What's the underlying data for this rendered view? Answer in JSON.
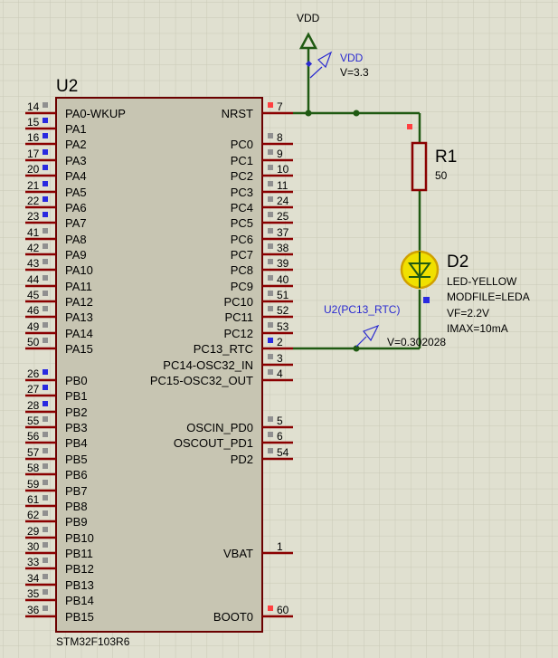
{
  "chip": {
    "ref": "U2",
    "part": "STM32F103R6",
    "left_pins": [
      {
        "num": "14",
        "name": "PA0-WKUP",
        "state": "gray"
      },
      {
        "num": "15",
        "name": "PA1",
        "state": "blue"
      },
      {
        "num": "16",
        "name": "PA2",
        "state": "blue"
      },
      {
        "num": "17",
        "name": "PA3",
        "state": "blue"
      },
      {
        "num": "20",
        "name": "PA4",
        "state": "blue"
      },
      {
        "num": "21",
        "name": "PA5",
        "state": "blue"
      },
      {
        "num": "22",
        "name": "PA6",
        "state": "blue"
      },
      {
        "num": "23",
        "name": "PA7",
        "state": "blue"
      },
      {
        "num": "41",
        "name": "PA8",
        "state": "gray"
      },
      {
        "num": "42",
        "name": "PA9",
        "state": "gray"
      },
      {
        "num": "43",
        "name": "PA10",
        "state": "gray"
      },
      {
        "num": "44",
        "name": "PA11",
        "state": "gray"
      },
      {
        "num": "45",
        "name": "PA12",
        "state": "gray"
      },
      {
        "num": "46",
        "name": "PA13",
        "state": "gray"
      },
      {
        "num": "49",
        "name": "PA14",
        "state": "gray"
      },
      {
        "num": "50",
        "name": "PA15",
        "state": "gray"
      },
      {
        "num": "26",
        "name": "PB0",
        "state": "blue"
      },
      {
        "num": "27",
        "name": "PB1",
        "state": "blue"
      },
      {
        "num": "28",
        "name": "PB2",
        "state": "blue"
      },
      {
        "num": "55",
        "name": "PB3",
        "state": "gray"
      },
      {
        "num": "56",
        "name": "PB4",
        "state": "gray"
      },
      {
        "num": "57",
        "name": "PB5",
        "state": "gray"
      },
      {
        "num": "58",
        "name": "PB6",
        "state": "gray"
      },
      {
        "num": "59",
        "name": "PB7",
        "state": "gray"
      },
      {
        "num": "61",
        "name": "PB8",
        "state": "gray"
      },
      {
        "num": "62",
        "name": "PB9",
        "state": "gray"
      },
      {
        "num": "29",
        "name": "PB10",
        "state": "gray"
      },
      {
        "num": "30",
        "name": "PB11",
        "state": "gray"
      },
      {
        "num": "33",
        "name": "PB12",
        "state": "gray"
      },
      {
        "num": "34",
        "name": "PB13",
        "state": "gray"
      },
      {
        "num": "35",
        "name": "PB14",
        "state": "gray"
      },
      {
        "num": "36",
        "name": "PB15",
        "state": "gray"
      }
    ],
    "right_pins": [
      {
        "num": "7",
        "name": "NRST",
        "state": "red"
      },
      {
        "num": "8",
        "name": "PC0",
        "state": "gray"
      },
      {
        "num": "9",
        "name": "PC1",
        "state": "gray"
      },
      {
        "num": "10",
        "name": "PC2",
        "state": "gray"
      },
      {
        "num": "11",
        "name": "PC3",
        "state": "gray"
      },
      {
        "num": "24",
        "name": "PC4",
        "state": "gray"
      },
      {
        "num": "25",
        "name": "PC5",
        "state": "gray"
      },
      {
        "num": "37",
        "name": "PC6",
        "state": "gray"
      },
      {
        "num": "38",
        "name": "PC7",
        "state": "gray"
      },
      {
        "num": "39",
        "name": "PC8",
        "state": "gray"
      },
      {
        "num": "40",
        "name": "PC9",
        "state": "gray"
      },
      {
        "num": "51",
        "name": "PC10",
        "state": "gray"
      },
      {
        "num": "52",
        "name": "PC11",
        "state": "gray"
      },
      {
        "num": "53",
        "name": "PC12",
        "state": "gray"
      },
      {
        "num": "2",
        "name": "PC13_RTC",
        "state": "blue"
      },
      {
        "num": "3",
        "name": "PC14-OSC32_IN",
        "state": "gray"
      },
      {
        "num": "4",
        "name": "PC15-OSC32_OUT",
        "state": "gray"
      },
      {
        "num": "5",
        "name": "OSCIN_PD0",
        "state": "gray"
      },
      {
        "num": "6",
        "name": "OSCOUT_PD1",
        "state": "gray"
      },
      {
        "num": "54",
        "name": "PD2",
        "state": "gray"
      },
      {
        "num": "1",
        "name": "VBAT",
        "state": "none"
      },
      {
        "num": "60",
        "name": "BOOT0",
        "state": "red"
      }
    ]
  },
  "vdd": {
    "label": "VDD",
    "probe_name": "VDD",
    "probe_value": "V=3.3"
  },
  "resistor": {
    "ref": "R1",
    "value": "50"
  },
  "led": {
    "ref": "D2",
    "type": "LED-YELLOW",
    "modfile": "MODFILE=LEDA",
    "vf": "VF=2.2V",
    "imax": "IMAX=10mA"
  },
  "probe_pc13": {
    "name": "U2(PC13_RTC)",
    "value": "V=0.302028"
  },
  "colors": {
    "background": "#e0e0d0",
    "grid": "#c9c9b6",
    "chip_fill": "#c7c5b2",
    "chip_border": "#6b0000",
    "wire": "#1f5a12",
    "pin": "#8a0000",
    "text": "#000000",
    "probe": "#2a2ad0",
    "led_fill": "#f0e000",
    "led_ring": "#d0a000",
    "high": "#ff4040",
    "low": "#2a2ae0",
    "float": "#909090"
  }
}
